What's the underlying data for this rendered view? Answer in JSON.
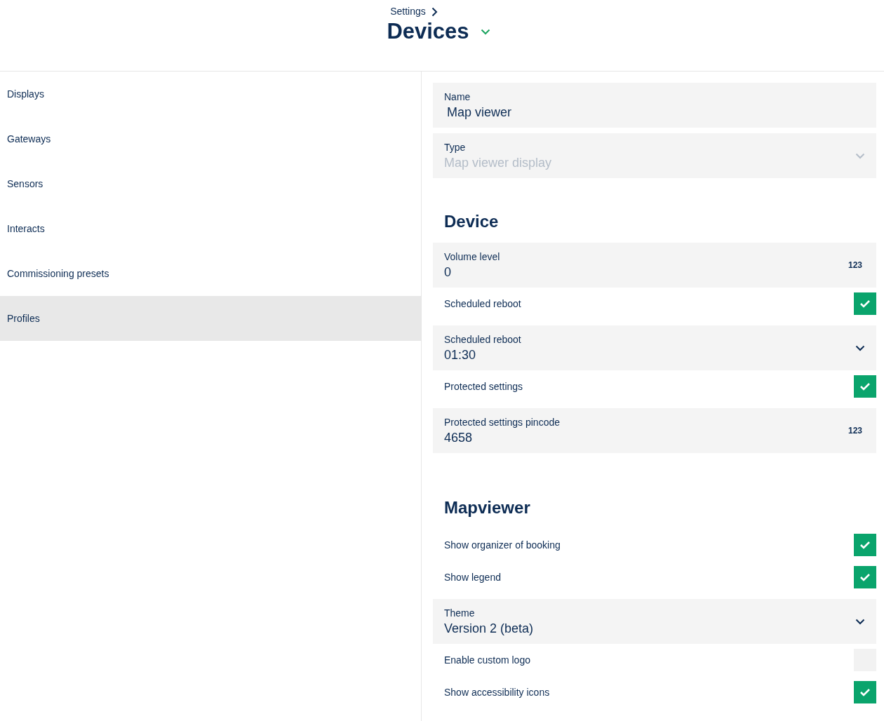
{
  "header": {
    "breadcrumb": "Settings",
    "title": "Devices"
  },
  "sidebar": {
    "items": [
      {
        "label": "Displays",
        "selected": false
      },
      {
        "label": "Gateways",
        "selected": false
      },
      {
        "label": "Sensors",
        "selected": false
      },
      {
        "label": "Interacts",
        "selected": false
      },
      {
        "label": "Commissioning presets",
        "selected": false
      },
      {
        "label": "Profiles",
        "selected": true
      }
    ]
  },
  "fields": [
    {
      "kind": "text",
      "label": "Name",
      "value": "Map viewer"
    },
    {
      "kind": "select",
      "label": "Type",
      "value": "Map viewer display",
      "disabled": true
    }
  ],
  "sections": [
    {
      "title": "Device",
      "items": [
        {
          "kind": "number",
          "label": "Volume level",
          "value": "0",
          "badge": "123"
        },
        {
          "kind": "checkbox",
          "label": "Scheduled reboot",
          "checked": true
        },
        {
          "kind": "select",
          "label": "Scheduled reboot",
          "value": "01:30",
          "disabled": false
        },
        {
          "kind": "checkbox",
          "label": "Protected settings",
          "checked": true
        },
        {
          "kind": "number",
          "label": "Protected settings pincode",
          "value": "4658",
          "badge": "123"
        }
      ]
    },
    {
      "title": "Mapviewer",
      "items": [
        {
          "kind": "checkbox",
          "label": "Show organizer of booking",
          "checked": true
        },
        {
          "kind": "checkbox",
          "label": "Show legend",
          "checked": true
        },
        {
          "kind": "select",
          "label": "Theme",
          "value": "Version 2 (beta)",
          "disabled": false
        },
        {
          "kind": "checkbox",
          "label": "Enable custom logo",
          "checked": false
        },
        {
          "kind": "checkbox",
          "label": "Show accessibility icons",
          "checked": true
        }
      ]
    }
  ]
}
